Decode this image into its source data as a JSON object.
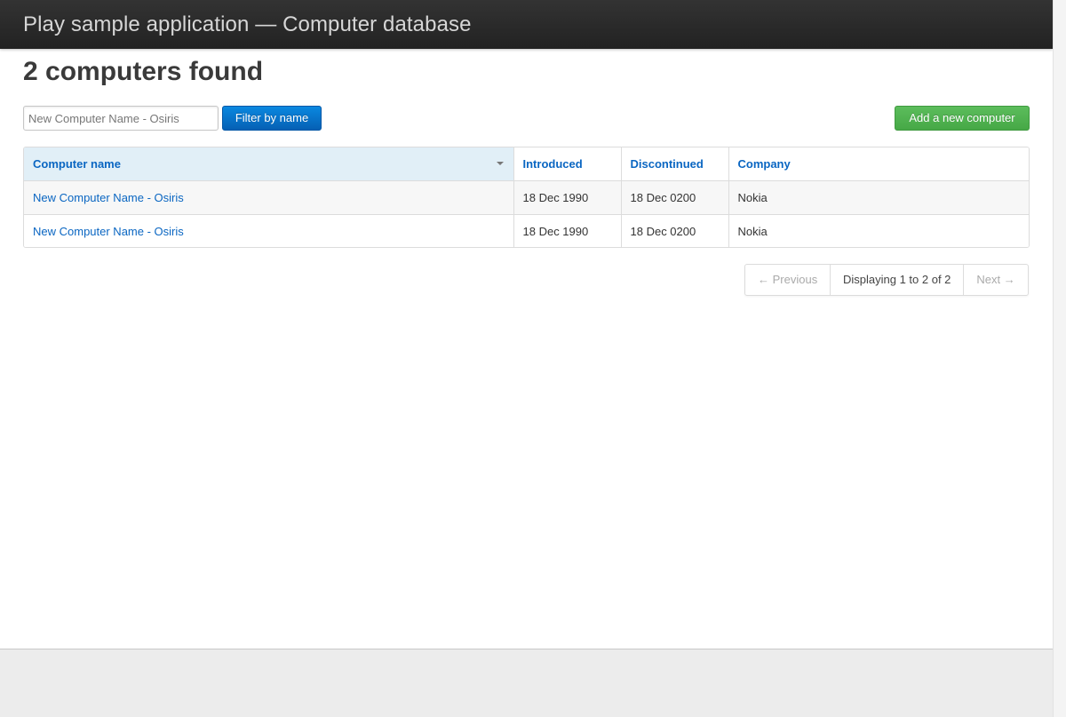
{
  "header": {
    "app_title": "Play sample application — Computer database"
  },
  "main": {
    "heading": "2 computers found",
    "filter": {
      "value": "",
      "placeholder": "New Computer Name - Osiris",
      "button_label": "Filter by name"
    },
    "add_button_label": "Add a new computer"
  },
  "table": {
    "columns": {
      "name": "Computer name",
      "introduced": "Introduced",
      "discontinued": "Discontinued",
      "company": "Company"
    },
    "sorted_column": "Computer name",
    "rows": [
      {
        "name": "New Computer Name - Osiris",
        "introduced": "18 Dec 1990",
        "discontinued": "18 Dec 0200",
        "company": "Nokia"
      },
      {
        "name": "New Computer Name - Osiris",
        "introduced": "18 Dec 1990",
        "discontinued": "18 Dec 0200",
        "company": "Nokia"
      }
    ]
  },
  "pagination": {
    "previous_label": "← Previous",
    "current_label": "Displaying 1 to 2 of 2",
    "next_label": "Next →"
  },
  "colors": {
    "topbar": "#222222",
    "link": "#0a66c2",
    "primary_button": "#0560b4",
    "success_button": "#46a846",
    "sorted_header_bg": "#e1eff7"
  },
  "icons": {
    "sort": "caret-down-icon"
  }
}
